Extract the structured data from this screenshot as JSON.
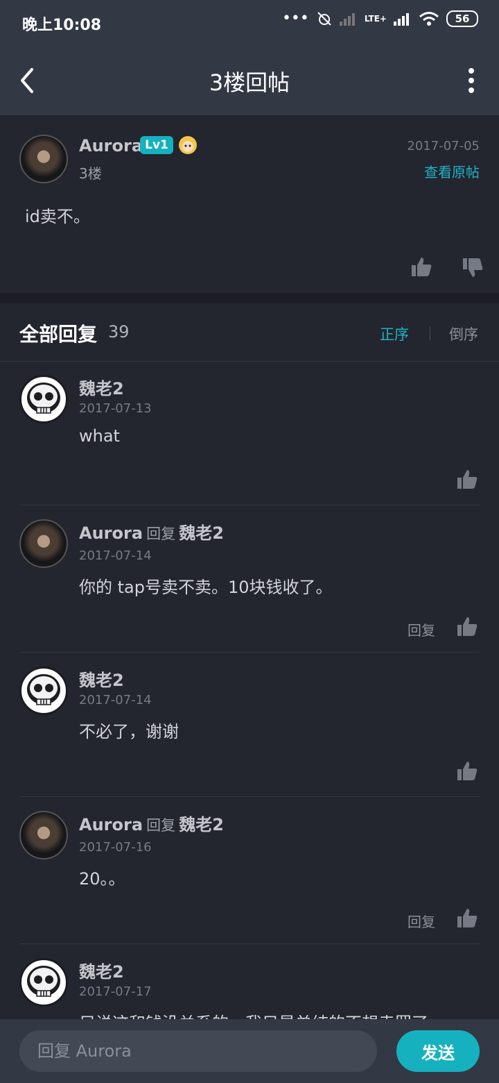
{
  "status_bar": {
    "time": "晚上10:08",
    "network": "LTE+",
    "battery": "56"
  },
  "nav": {
    "title": "3楼回帖"
  },
  "post": {
    "author": "Aurora",
    "level": "Lv1",
    "date": "2017-07-05",
    "floor": "3楼",
    "view_original": "查看原帖",
    "content": "id卖不。"
  },
  "replies_header": {
    "title": "全部回复",
    "count": "39",
    "sort_asc": "正序",
    "sort_desc": "倒序"
  },
  "reply_label": "回复",
  "replies": [
    {
      "author": "魏老2",
      "date": "2017-07-13",
      "content": "what"
    },
    {
      "author": "Aurora",
      "reply_word": "回复",
      "reply_to": "魏老2",
      "date": "2017-07-14",
      "content": "你的 tap号卖不卖。10块钱收了。",
      "reply_action": "回复"
    },
    {
      "author": "魏老2",
      "date": "2017-07-14",
      "content": "不必了，谢谢"
    },
    {
      "author": "Aurora",
      "reply_word": "回复",
      "reply_to": "魏老2",
      "date": "2017-07-16",
      "content": "20。。",
      "reply_action": "回复"
    },
    {
      "author": "魏老2",
      "date": "2017-07-17",
      "content": "只说这和钱没关系的，我只是单纯的不想卖罢了"
    }
  ],
  "bottom_bar": {
    "input_placeholder": "回复 Aurora",
    "send_label": "发送"
  },
  "colors": {
    "accent": "#16b1bf",
    "background": "#23252f",
    "header": "#333845"
  }
}
